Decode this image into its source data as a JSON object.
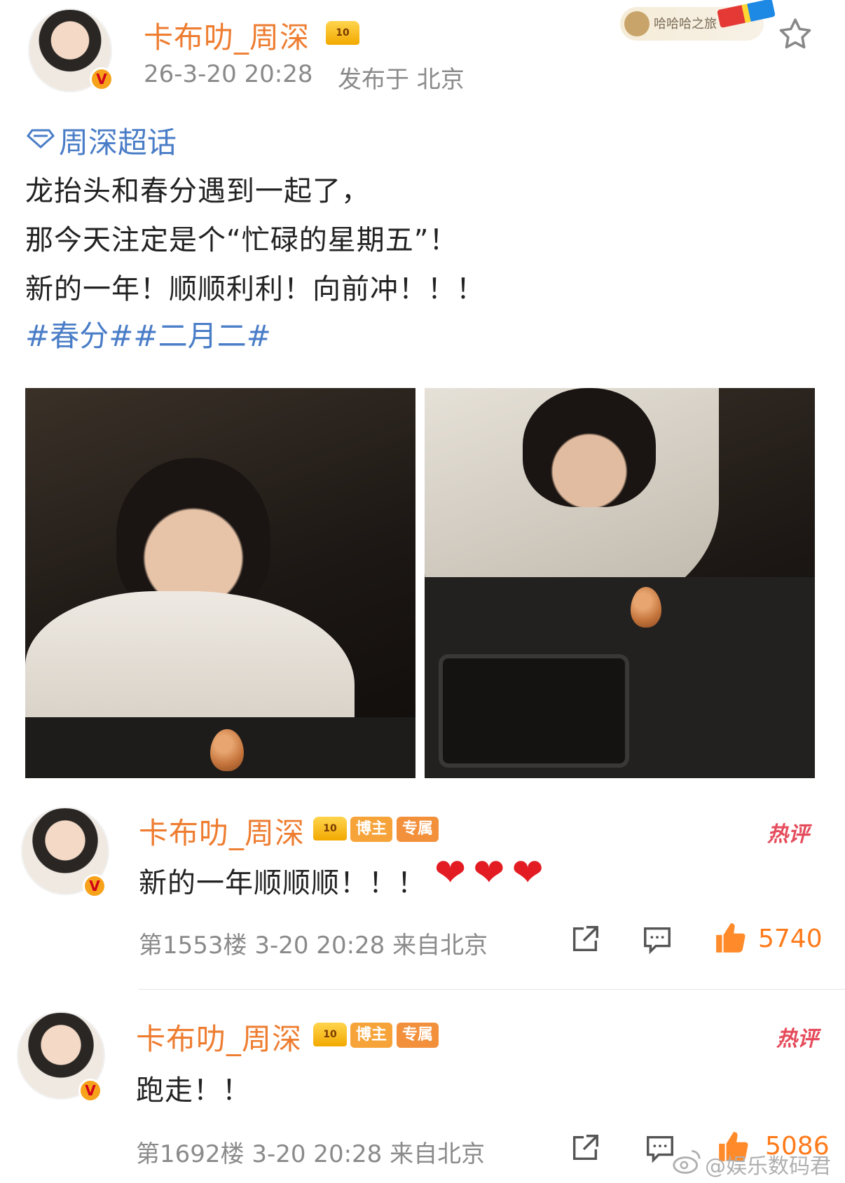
{
  "post": {
    "author": "卡布叻_周深",
    "crown_badge": "10",
    "timestamp": "26-3-20 20:28",
    "location": "发布于 北京",
    "topic": "周深超话",
    "lines": [
      "龙抬头和春分遇到一起了，",
      "那今天注定是个“忙碌的星期五”！",
      "新的一年！顺顺利利！向前冲！！！"
    ],
    "hashtags": "#春分##二月二#",
    "top_right_badge": "哈哈哈之旅"
  },
  "comments": [
    {
      "author": "卡布叻_周深",
      "crown_badge": "10",
      "tag_blogger": "博主",
      "tag_exclusive": "专属",
      "hot_label": "热评",
      "text": "新的一年顺顺顺！！！",
      "hearts": "❤❤❤",
      "floor_meta": "第1553楼 3-20 20:28 来自北京",
      "likes": "5740"
    },
    {
      "author": "卡布叻_周深",
      "crown_badge": "10",
      "tag_blogger": "博主",
      "tag_exclusive": "专属",
      "hot_label": "热评",
      "text": "跑走！！",
      "hearts": "",
      "floor_meta": "第1692楼 3-20 20:28 来自北京",
      "likes": "5086"
    }
  ],
  "watermark": "@娱乐数码君",
  "colors": {
    "username": "#ee7d31",
    "link": "#4a7dc7",
    "meta": "#8a8a8a",
    "like": "#ff7a1a",
    "hot": "#e54b5b"
  }
}
